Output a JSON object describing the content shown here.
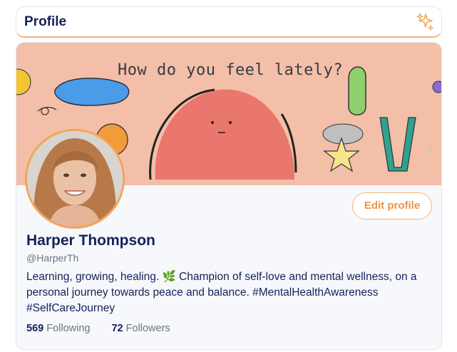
{
  "header": {
    "title": "Profile",
    "sparkle_icon": "sparkle-icon"
  },
  "banner": {
    "text": "How do you feel lately?"
  },
  "profile": {
    "name": "Harper Thompson",
    "handle": "@HarperTh",
    "bio_part1": "Learning, growing, healing. ",
    "bio_emoji": "🌿",
    "bio_part2": " Champion of self-love and mental wellness, on a personal journey towards peace and balance. #MentalHealthAwareness #SelfCareJourney",
    "edit_label": "Edit profile"
  },
  "stats": {
    "following_count": "569",
    "following_label": "Following",
    "followers_count": "72",
    "followers_label": "Followers"
  },
  "colors": {
    "accent": "#ee9544",
    "navy": "#14215a",
    "banner": "#f3bfa8"
  }
}
